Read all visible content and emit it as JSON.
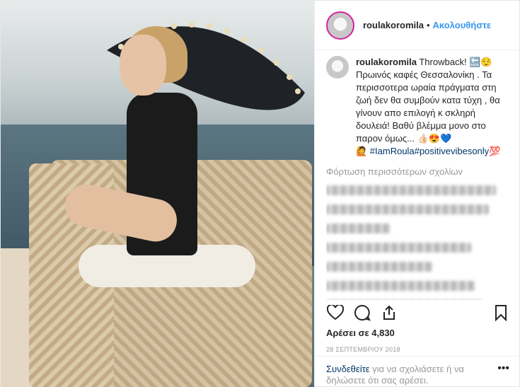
{
  "post": {
    "username": "roulakoromila",
    "separator": "•",
    "follow_label": "Ακολουθήστε",
    "caption_user": "roulakoromila",
    "caption_text": "Throwback! 🔙😌Πρωινός καφές Θεσσαλονίκη . Τα περισσοτερα ωραία πράγματα στη ζωή δεν θα συμβούν κατα τύχη , θα γίνουν απο επιλογή κ σκληρή δουλειά! Βαθύ βλέμμα μονο στο παρον όμως... 👍🏻😍💙",
    "caption_tags": "🙋 #IamRoula#positivevibesonly💯",
    "load_more_label": "Φόρτωση περισσότερων σχολίων",
    "likes_text": "Αρέσει σε 4,830",
    "date_text": "28 ΣΕΠΤΕΜΒΡΙΟΥ 2018",
    "login_link": "Συνδεθείτε",
    "login_rest": " για να σχολιάσετε ή να δηλώσετε ότι σας αρέσει.",
    "more_label": "•••"
  },
  "icons": {
    "like": "heart-icon",
    "comment": "comment-icon",
    "share": "share-icon",
    "save": "bookmark-icon"
  },
  "colors": {
    "accent": "#3897f0",
    "link": "#003569",
    "muted": "#999999"
  }
}
